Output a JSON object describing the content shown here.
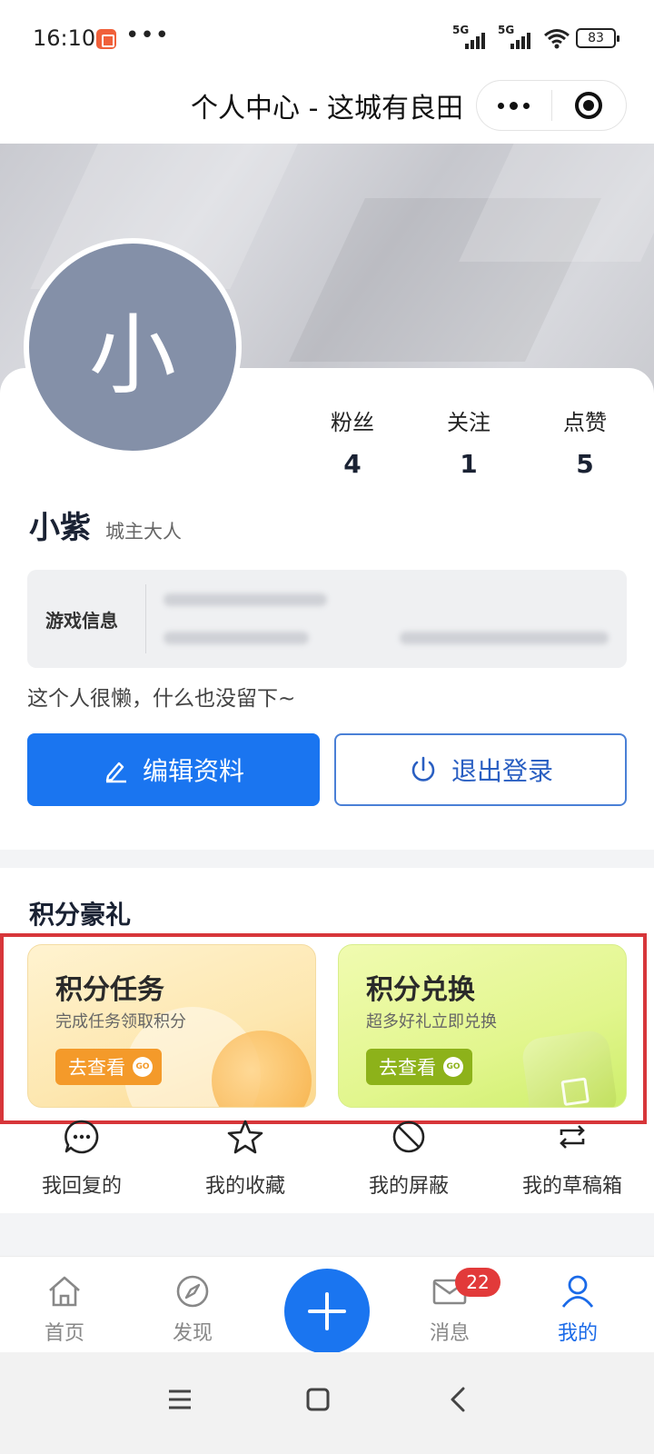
{
  "status_bar": {
    "time": "16:10",
    "dots": "•••",
    "signal_1": "5G",
    "signal_2": "5G",
    "battery": "83"
  },
  "header": {
    "title": "个人中心 - 这城有良田"
  },
  "profile": {
    "avatar_char": "小",
    "name": "小紫",
    "title": "城主大人",
    "stats": [
      {
        "label": "粉丝",
        "value": "4"
      },
      {
        "label": "关注",
        "value": "1"
      },
      {
        "label": "点赞",
        "value": "5"
      }
    ],
    "game_info_label": "游戏信息",
    "bio": "这个人很懒，什么也没留下~",
    "edit_button": "编辑资料",
    "logout_button": "退出登录"
  },
  "points": {
    "section_title": "积分豪礼",
    "cards": [
      {
        "title": "积分任务",
        "subtitle": "完成任务领取积分",
        "button": "去查看",
        "go": "GO"
      },
      {
        "title": "积分兑换",
        "subtitle": "超多好礼立即兑换",
        "button": "去查看",
        "go": "GO"
      }
    ]
  },
  "quick_links": [
    {
      "label": "我回复的",
      "icon": "chat-bubble-icon"
    },
    {
      "label": "我的收藏",
      "icon": "star-icon"
    },
    {
      "label": "我的屏蔽",
      "icon": "block-icon"
    },
    {
      "label": "我的草稿箱",
      "icon": "repeat-icon"
    }
  ],
  "tabbar": {
    "tabs": [
      {
        "label": "首页",
        "icon": "home-icon"
      },
      {
        "label": "发现",
        "icon": "compass-icon"
      },
      {
        "label": "消息",
        "icon": "mail-icon",
        "badge": "22"
      },
      {
        "label": "我的",
        "icon": "user-icon",
        "active": true
      }
    ]
  },
  "colors": {
    "primary": "#1a75f0",
    "highlight_border": "#d7363a",
    "task_button": "#f49a2a",
    "exchange_button": "#8db21a",
    "badge": "#e23a3a"
  }
}
